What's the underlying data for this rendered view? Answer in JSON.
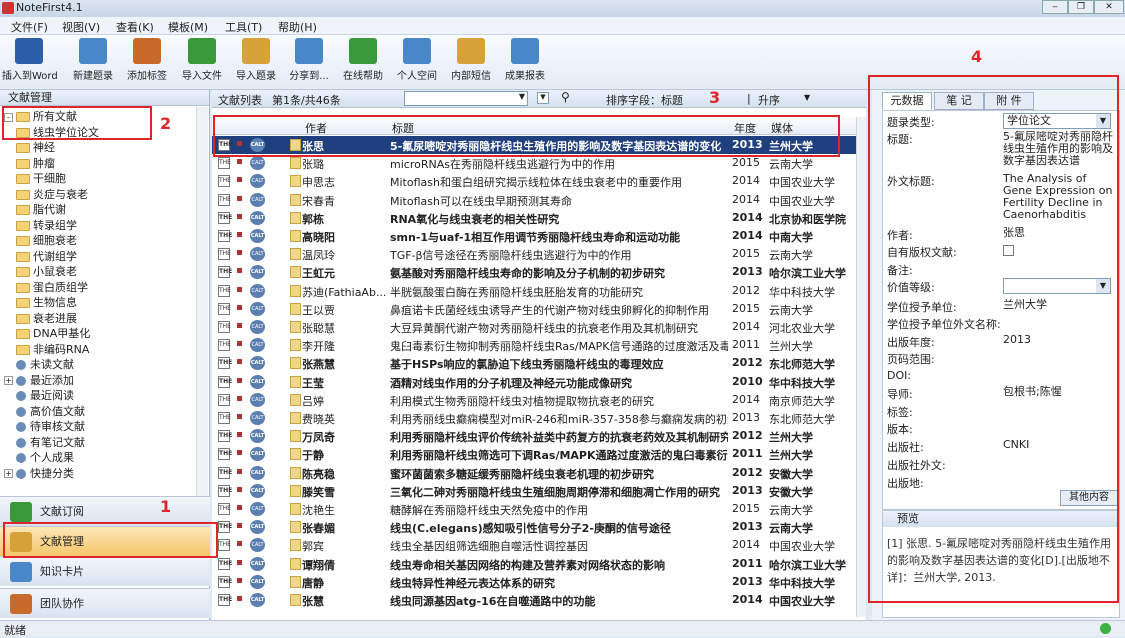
{
  "app": {
    "title": "NoteFirst4.1"
  },
  "menu": [
    "文件(F)",
    "视图(V)",
    "查看(K)",
    "模板(M)",
    "工具(T)",
    "帮助(H)"
  ],
  "toolbar": [
    "插入到Word",
    "新建题录",
    "添加标签",
    "导入文件",
    "导入题录",
    "分享到...",
    "在线帮助",
    "个人空间",
    "内部短信",
    "成果报表"
  ],
  "left": {
    "header": "文献管理",
    "tree": [
      {
        "label": "所有文献",
        "level": 0,
        "type": "folder",
        "exp": "-"
      },
      {
        "label": "线虫学位论文",
        "level": 1,
        "type": "folder"
      },
      {
        "label": "神经",
        "level": 1,
        "type": "folder"
      },
      {
        "label": "肿瘤",
        "level": 1,
        "type": "folder"
      },
      {
        "label": "干细胞",
        "level": 1,
        "type": "folder"
      },
      {
        "label": "炎症与衰老",
        "level": 1,
        "type": "folder"
      },
      {
        "label": "脂代谢",
        "level": 1,
        "type": "folder"
      },
      {
        "label": "转录组学",
        "level": 1,
        "type": "folder"
      },
      {
        "label": "细胞衰老",
        "level": 1,
        "type": "folder"
      },
      {
        "label": "代谢组学",
        "level": 1,
        "type": "folder"
      },
      {
        "label": "小鼠衰老",
        "level": 1,
        "type": "folder"
      },
      {
        "label": "蛋白质组学",
        "level": 1,
        "type": "folder"
      },
      {
        "label": "生物信息",
        "level": 1,
        "type": "folder"
      },
      {
        "label": "衰老进展",
        "level": 1,
        "type": "folder"
      },
      {
        "label": "DNA甲基化",
        "level": 1,
        "type": "folder"
      },
      {
        "label": "非编码RNA",
        "level": 1,
        "type": "folder"
      },
      {
        "label": "未读文献",
        "level": 0,
        "type": "node"
      },
      {
        "label": "最近添加",
        "level": 0,
        "type": "node",
        "exp": "+"
      },
      {
        "label": "最近阅读",
        "level": 0,
        "type": "node"
      },
      {
        "label": "高价值文献",
        "level": 0,
        "type": "node"
      },
      {
        "label": "待审核文献",
        "level": 0,
        "type": "node"
      },
      {
        "label": "有笔记文献",
        "level": 0,
        "type": "node"
      },
      {
        "label": "个人成果",
        "level": 0,
        "type": "node"
      },
      {
        "label": "快捷分类",
        "level": 0,
        "type": "node",
        "exp": "+"
      }
    ],
    "nav": [
      "文献订阅",
      "文献管理",
      "知识卡片",
      "团队协作"
    ]
  },
  "list": {
    "tab": "文献列表",
    "count": "第1条/共46条",
    "sort_label": "排序字段：标题",
    "order": "升序",
    "cols": {
      "author": "作者",
      "title": "标题",
      "year": "年度",
      "pub": "媒体"
    },
    "rows": [
      {
        "a": "张思",
        "t": "5-氟尿嘧啶对秀丽隐杆线虫生殖作用的影响及数字基因表达谱的变化",
        "y": "2013",
        "p": "兰州大学",
        "b": true,
        "sel": true
      },
      {
        "a": "张璐",
        "t": "microRNAs在秀丽隐杆线虫逃避行为中的作用",
        "y": "2015",
        "p": "云南大学",
        "b": false
      },
      {
        "a": "申思志",
        "t": "Mitoflash和蛋白组研究揭示线粒体在线虫衰老中的重要作用",
        "y": "2014",
        "p": "中国农业大学",
        "b": false
      },
      {
        "a": "宋春青",
        "t": "Mitoflash可以在线虫早期预测其寿命",
        "y": "2014",
        "p": "中国农业大学",
        "b": false
      },
      {
        "a": "郭栋",
        "t": "RNA氧化与线虫衰老的相关性研究",
        "y": "2014",
        "p": "北京协和医学院",
        "b": true
      },
      {
        "a": "高晓阳",
        "t": "smn-1与uaf-1相互作用调节秀丽隐杆线虫寿命和运动功能",
        "y": "2014",
        "p": "中南大学",
        "b": true
      },
      {
        "a": "温凤玲",
        "t": "TGF-β信号途径在秀丽隐杆线虫逃避行为中的作用",
        "y": "2015",
        "p": "云南大学",
        "b": false
      },
      {
        "a": "王虹元",
        "t": "氨基酸对秀丽隐杆线虫寿命的影响及分子机制的初步研究",
        "y": "2013",
        "p": "哈尔滨工业大学",
        "b": true
      },
      {
        "a": "苏迪(FathiaAb...",
        "t": "半胱氨酸蛋白酶在秀丽隐杆线虫胚胎发育的功能研究",
        "y": "2012",
        "p": "华中科技大学",
        "b": false
      },
      {
        "a": "王以贾",
        "t": "鼻疽诺卡氏菌经线虫诱导产生的代谢产物对线虫卵孵化的抑制作用",
        "y": "2015",
        "p": "云南大学",
        "b": false
      },
      {
        "a": "张聪慧",
        "t": "大豆异黄酮代谢产物对秀丽隐杆线虫的抗衰老作用及其机制研究",
        "y": "2014",
        "p": "河北农业大学",
        "b": false
      },
      {
        "a": "李开隆",
        "t": "鬼臼毒素衍生物抑制秀丽隐杆线虫Ras/MAPK信号通路的过度激活及毒...",
        "y": "2011",
        "p": "兰州大学",
        "b": false
      },
      {
        "a": "张燕慧",
        "t": "基于HSPs响应的氯胁迫下线虫秀丽隐杆线虫的毒理效应",
        "y": "2012",
        "p": "东北师范大学",
        "b": true
      },
      {
        "a": "王莹",
        "t": "酒精对线虫作用的分子机理及神经元功能成像研究",
        "y": "2010",
        "p": "华中科技大学",
        "b": true
      },
      {
        "a": "吕婷",
        "t": "利用模式生物秀丽隐杆线虫对植物提取物抗衰老的研究",
        "y": "2014",
        "p": "南京师范大学",
        "b": false
      },
      {
        "a": "费晓英",
        "t": "利用秀丽线虫癫痫模型对miR-246和miR-357-358参与癫痫发病的初步...",
        "y": "2013",
        "p": "东北师范大学",
        "b": false
      },
      {
        "a": "万凤奇",
        "t": "利用秀丽隐杆线虫评价传统补益类中药复方的抗衰老药效及其机制研究",
        "y": "2012",
        "p": "兰州大学",
        "b": true
      },
      {
        "a": "于静",
        "t": "利用秀丽隐杆线虫筛选可下调Ras/MAPK通路过度激活的鬼臼毒素衍生...",
        "y": "2011",
        "p": "兰州大学",
        "b": true
      },
      {
        "a": "陈亮稳",
        "t": "蜜环菌菌索多糖延缓秀丽隐杆线虫衰老机理的初步研究",
        "y": "2012",
        "p": "安徽大学",
        "b": true
      },
      {
        "a": "滕笑雪",
        "t": "三氧化二砷对秀丽隐杆线虫生殖细胞周期停滞和细胞凋亡作用的研究",
        "y": "2013",
        "p": "安徽大学",
        "b": true
      },
      {
        "a": "沈艳生",
        "t": "糖酵解在秀丽隐杆线虫天然免疫中的作用",
        "y": "2015",
        "p": "云南大学",
        "b": false
      },
      {
        "a": "张春媚",
        "t": "线虫(C.elegans)感知吸引性信号分子2-庚酮的信号途径",
        "y": "2013",
        "p": "云南大学",
        "b": true
      },
      {
        "a": "郭宾",
        "t": "线虫全基因组筛选细胞自噬活性调控基因",
        "y": "2014",
        "p": "中国农业大学",
        "b": false
      },
      {
        "a": "谭翔倩",
        "t": "线虫寿命相关基因网络的构建及营养素对网络状态的影响",
        "y": "2011",
        "p": "哈尔滨工业大学",
        "b": true
      },
      {
        "a": "唐静",
        "t": "线虫特异性神经元表达体系的研究",
        "y": "2013",
        "p": "华中科技大学",
        "b": true
      },
      {
        "a": "张慧",
        "t": "线虫同源基因atg-16在自噬通路中的功能",
        "y": "2014",
        "p": "中国农业大学",
        "b": true
      }
    ]
  },
  "right": {
    "tabs": [
      "元数据",
      "笔 记",
      "附 件"
    ],
    "props": [
      {
        "l": "题录类型:",
        "v": "学位论文",
        "sel": true
      },
      {
        "l": "标题:",
        "v": "5-氟尿嘧啶对秀丽隐杆线虫生殖作用的影响及数字基因表达谱"
      },
      {
        "l": "外文标题:",
        "v": "The Analysis of Gene Expression on Fertility Decline in Caenorhabditis"
      },
      {
        "l": "作者:",
        "v": "张思"
      },
      {
        "l": "自有版权文献:",
        "v": ""
      },
      {
        "l": "备注:",
        "v": ""
      },
      {
        "l": "价值等级:",
        "v": "",
        "sel": true
      },
      {
        "l": "学位授予单位:",
        "v": "兰州大学"
      },
      {
        "l": "学位授予单位外文名称:",
        "v": ""
      },
      {
        "l": "出版年度:",
        "v": "2013"
      },
      {
        "l": "页码范围:",
        "v": ""
      },
      {
        "l": "DOI:",
        "v": ""
      },
      {
        "l": "导师:",
        "v": "包根书;陈惺"
      },
      {
        "l": "标签:",
        "v": ""
      },
      {
        "l": "版本:",
        "v": ""
      },
      {
        "l": "出版社:",
        "v": "CNKI"
      },
      {
        "l": "出版社外文:",
        "v": ""
      },
      {
        "l": "出版地:",
        "v": ""
      }
    ],
    "more": "其他内容",
    "preview_title": "预览",
    "preview_text": "[1] 张思. 5-氟尿嘧啶对秀丽隐杆线虫生殖作用的影响及数字基因表达谱的变化[D].[出版地不详]：兰州大学, 2013."
  },
  "status": "就绪",
  "annotations": [
    "1",
    "2",
    "3",
    "4"
  ]
}
